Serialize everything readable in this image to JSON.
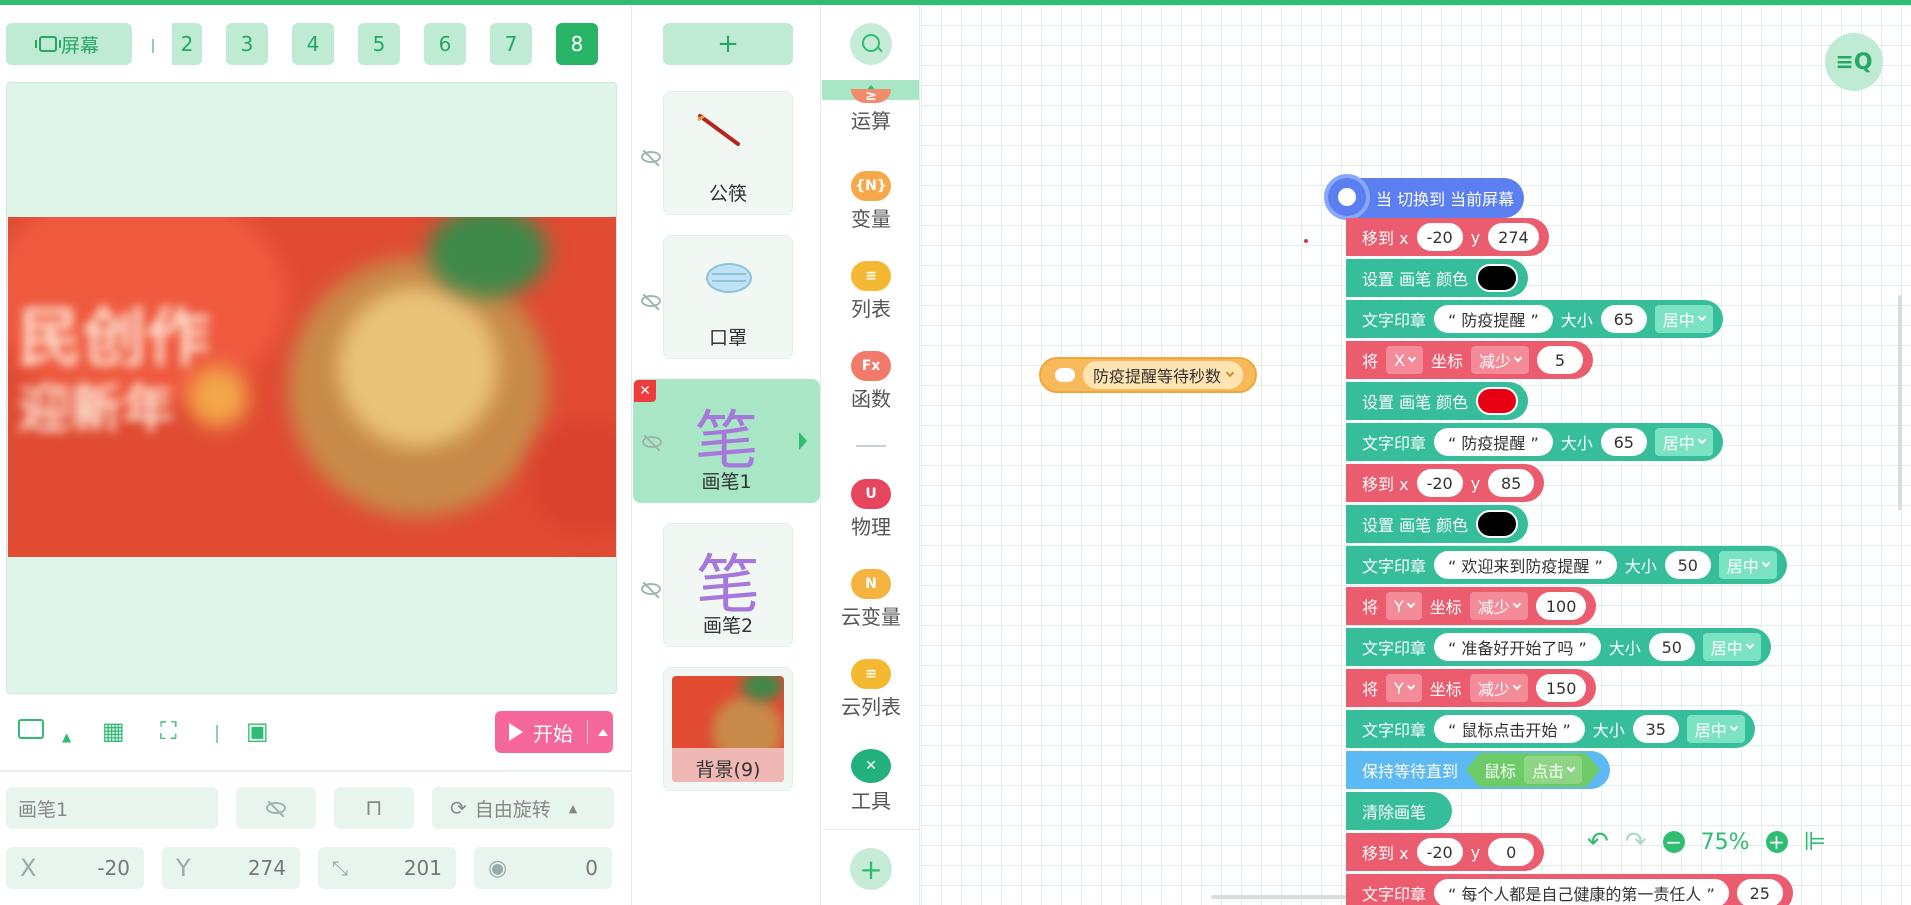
{
  "toolbar": {
    "screen_label": "屏幕",
    "pages": [
      "2",
      "3",
      "4",
      "5",
      "6",
      "7",
      "8"
    ],
    "active_page": "8"
  },
  "stage_controls": {
    "start_label": "开始"
  },
  "properties": {
    "sprite_name": "画笔1",
    "rotation_mode": "自由旋转",
    "x_label": "X",
    "x_value": "-20",
    "y_label": "Y",
    "y_value": "274",
    "size_value": "201",
    "direction_value": "0"
  },
  "sprites": {
    "add_label": "+",
    "items": [
      {
        "name": "公筷"
      },
      {
        "name": "口罩"
      },
      {
        "name": "画笔1",
        "glyph": "笔"
      },
      {
        "name": "画笔2",
        "glyph": "笔"
      },
      {
        "name": "背景(9)"
      }
    ]
  },
  "categories": [
    {
      "name": "运算",
      "badge": "≥",
      "color": "#f28b6b"
    },
    {
      "name": "变量",
      "badge": "{N}",
      "color": "#f7a94a"
    },
    {
      "name": "列表",
      "badge": "≡",
      "color": "#f5b833"
    },
    {
      "name": "函数",
      "badge": "Fx",
      "color": "#f27a6a"
    },
    {
      "name": "物理",
      "badge": "U",
      "color": "#e5455d"
    },
    {
      "name": "云变量",
      "badge": "N",
      "color": "#f6b340"
    },
    {
      "name": "云列表",
      "badge": "≡",
      "color": "#f5b833"
    },
    {
      "name": "工具",
      "badge": "✕",
      "color": "#22b07d"
    }
  ],
  "code": {
    "floating_var": "防疫提醒等待秒数",
    "hat": "当 切换到 当前屏幕",
    "blocks": [
      {
        "t": "移到 x",
        "a": "-20",
        "t2": "y",
        "b": "274"
      },
      {
        "t": "设置 画笔 颜色",
        "color": "#000000"
      },
      {
        "t": "文字印章",
        "s": "“ 防疫提醒 ”",
        "t2": "大小",
        "n": "65",
        "d": "居中"
      },
      {
        "t": "将",
        "axis": "X",
        "t2": "坐标",
        "op": "减少",
        "n": "5"
      },
      {
        "t": "设置 画笔 颜色",
        "color": "#e60012"
      },
      {
        "t": "文字印章",
        "s": "“ 防疫提醒 ”",
        "t2": "大小",
        "n": "65",
        "d": "居中"
      },
      {
        "t": "移到 x",
        "a": "-20",
        "t2": "y",
        "b": "85"
      },
      {
        "t": "设置 画笔 颜色",
        "color": "#000000"
      },
      {
        "t": "文字印章",
        "s": "“ 欢迎来到防疫提醒 ”",
        "t2": "大小",
        "n": "50",
        "d": "居中"
      },
      {
        "t": "将",
        "axis": "Y",
        "t2": "坐标",
        "op": "减少",
        "n": "100"
      },
      {
        "t": "文字印章",
        "s": "“ 准备好开始了吗 ”",
        "t2": "大小",
        "n": "50",
        "d": "居中"
      },
      {
        "t": "将",
        "axis": "Y",
        "t2": "坐标",
        "op": "减少",
        "n": "150"
      },
      {
        "t": "文字印章",
        "s": "“ 鼠标点击开始 ”",
        "t2": "大小",
        "n": "35",
        "d": "居中"
      },
      {
        "t": "保持等待直到",
        "c1": "鼠标",
        "c2": "点击"
      },
      {
        "t": "清除画笔"
      },
      {
        "t": "移到 x",
        "a": "-20",
        "t2": "y",
        "b": "0"
      },
      {
        "t": "文字印章",
        "s": "“ 每个人都是自己健康的第一责任人 ”",
        "n": "25"
      }
    ]
  },
  "zoom": {
    "level": "75%"
  },
  "colors": {
    "accent": "#2ebd72",
    "motion": "#ec5c6f",
    "pen": "#36bd9a",
    "control": "#5db9f4",
    "event": "#5b7ff0",
    "start": "#f5679a"
  }
}
